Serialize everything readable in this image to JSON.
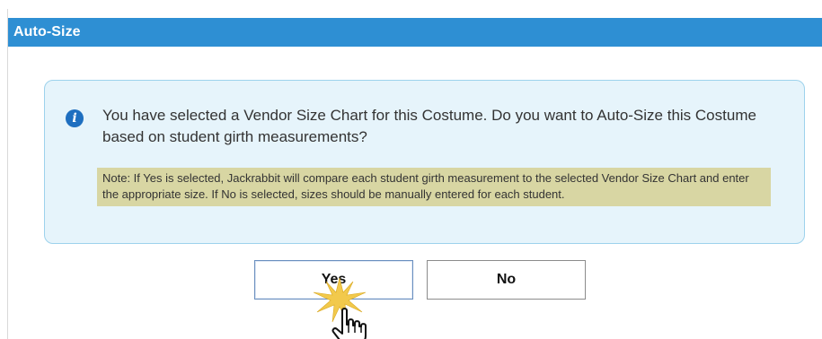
{
  "dialog": {
    "title": "Auto-Size",
    "message": "You have selected a Vendor Size Chart for this Costume. Do you want to Auto-Size this Costume based on student girth measurements?",
    "note": "Note: If Yes is selected, Jackrabbit will compare each student girth measurement to the selected Vendor Size Chart and enter the appropriate size. If No is selected, sizes should be manually entered for each student.",
    "info_icon": "info-circle-icon",
    "yes_label": "Yes",
    "no_label": "No"
  },
  "colors": {
    "titlebar": "#2e8fd3",
    "info_background": "#e6f4fb",
    "info_border": "#9dd2ec",
    "note_background": "#d8d6a3",
    "info_icon": "#1e6fc0",
    "click_burst": "#f2c94c"
  },
  "cursor": {
    "icon": "hand-pointer-icon"
  }
}
